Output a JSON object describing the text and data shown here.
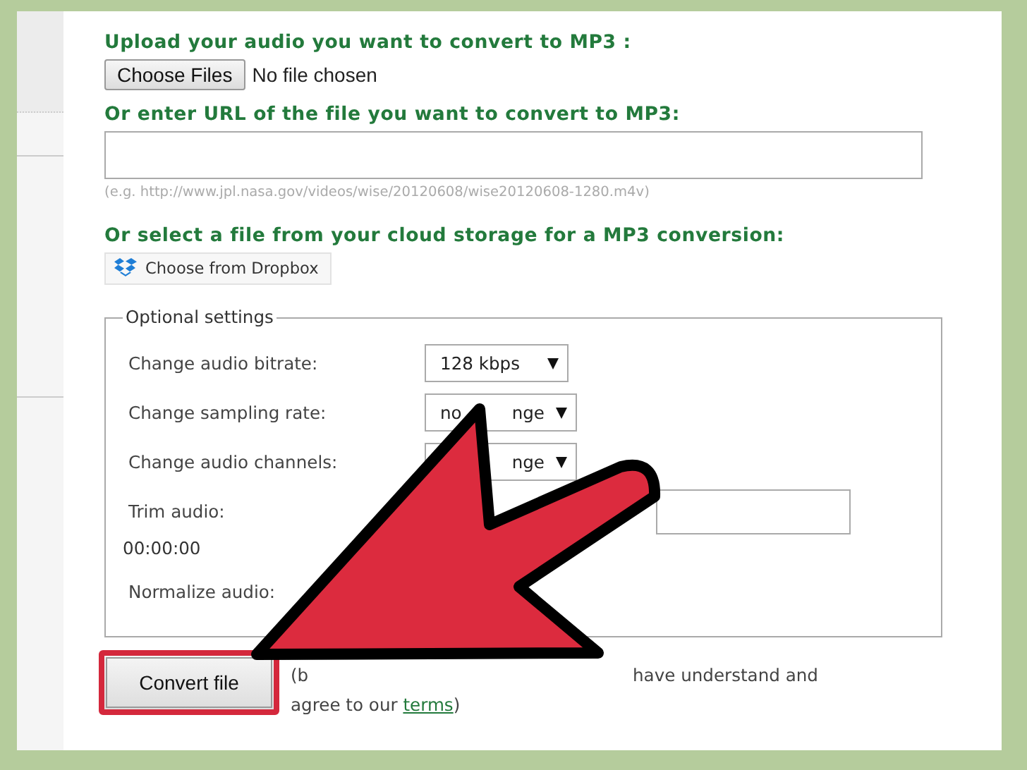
{
  "upload": {
    "heading": "Upload your audio you want to convert to MP3 :",
    "button": "Choose Files",
    "status": "No file chosen"
  },
  "url": {
    "heading": "Or enter URL of the file you want to convert to MP3:",
    "hint": "(e.g. http://www.jpl.nasa.gov/videos/wise/20120608/wise20120608-1280.m4v)"
  },
  "cloud": {
    "heading": "Or select a file from your cloud storage for a MP3 conversion:",
    "button": "Choose from Dropbox"
  },
  "optional_settings": {
    "legend": "Optional settings",
    "rows": [
      {
        "kind": "select",
        "label": "Change audio bitrate:",
        "value": "128 kbps"
      },
      {
        "kind": "select",
        "label": "Change sampling rate:",
        "value_parts": [
          "no",
          "nge"
        ]
      },
      {
        "kind": "select",
        "label": "Change audio channels:",
        "value_parts": [
          "nge"
        ]
      },
      {
        "kind": "trim",
        "label": "Trim audio:",
        "time": "00:00:00"
      },
      {
        "kind": "plain",
        "label": "Normalize audio:"
      }
    ]
  },
  "convert": {
    "button": "Convert file",
    "note_parts": [
      "(b",
      "have understand and"
    ],
    "note_line2": "agree to our",
    "link": "terms",
    "note_end": ")"
  }
}
